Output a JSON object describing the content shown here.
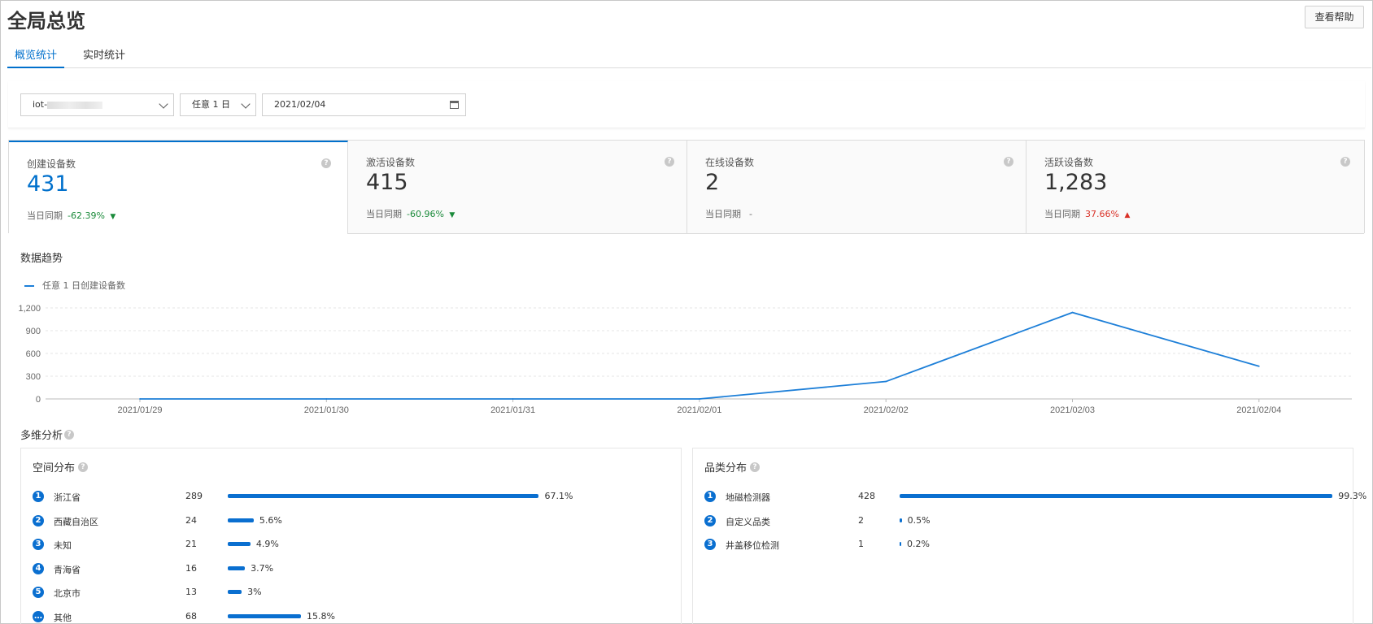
{
  "page": {
    "title": "全局总览",
    "help_label": "查看帮助"
  },
  "tabs": [
    {
      "label": "概览统计"
    },
    {
      "label": "实时统计"
    }
  ],
  "filters": {
    "instance_prefix": "iot-",
    "period": "任意 1 日",
    "date": "2021/02/04"
  },
  "cards": [
    {
      "label": "创建设备数",
      "value": "431",
      "meta_label": "当日同期",
      "pct": "-62.39%",
      "trend": "down"
    },
    {
      "label": "激活设备数",
      "value": "415",
      "meta_label": "当日同期",
      "pct": "-60.96%",
      "trend": "down"
    },
    {
      "label": "在线设备数",
      "value": "2",
      "meta_label": "当日同期",
      "pct": "-",
      "trend": "none"
    },
    {
      "label": "活跃设备数",
      "value": "1,283",
      "meta_label": "当日同期",
      "pct": "37.66%",
      "trend": "up"
    }
  ],
  "trend_title": "数据趋势",
  "chart_data": {
    "type": "line",
    "title": "",
    "series": [
      {
        "name": "任意 1 日创建设备数",
        "values": [
          0,
          0,
          0,
          0,
          230,
          1140,
          431
        ]
      }
    ],
    "x": [
      "2021/01/29",
      "2021/01/30",
      "2021/01/31",
      "2021/02/01",
      "2021/02/02",
      "2021/02/03",
      "2021/02/04"
    ],
    "yticks": [
      "0",
      "300",
      "600",
      "900",
      "1,200"
    ],
    "ylim": [
      0,
      1200
    ],
    "grid": true,
    "color": "#1d7fd8"
  },
  "analysis_title": "多维分析",
  "space": {
    "title": "空间分布",
    "rows": [
      {
        "rank": "1",
        "name": "浙江省",
        "count": "289",
        "pct_label": "67.1%",
        "pct": 67.1
      },
      {
        "rank": "2",
        "name": "西藏自治区",
        "count": "24",
        "pct_label": "5.6%",
        "pct": 5.6
      },
      {
        "rank": "3",
        "name": "未知",
        "count": "21",
        "pct_label": "4.9%",
        "pct": 4.9
      },
      {
        "rank": "4",
        "name": "青海省",
        "count": "16",
        "pct_label": "3.7%",
        "pct": 3.7
      },
      {
        "rank": "5",
        "name": "北京市",
        "count": "13",
        "pct_label": "3%",
        "pct": 3
      },
      {
        "rank": "…",
        "name": "其他",
        "count": "68",
        "pct_label": "15.8%",
        "pct": 15.8
      }
    ]
  },
  "category": {
    "title": "品类分布",
    "rows": [
      {
        "rank": "1",
        "name": "地磁检测器",
        "count": "428",
        "pct_label": "99.3%",
        "pct": 99.3
      },
      {
        "rank": "2",
        "name": "自定义品类",
        "count": "2",
        "pct_label": "0.5%",
        "pct": 0.5
      },
      {
        "rank": "3",
        "name": "井盖移位检测",
        "count": "1",
        "pct_label": "0.2%",
        "pct": 0.2
      }
    ]
  },
  "colors": {
    "accent": "#0070cc",
    "down": "#1a8a3a",
    "up": "#d93026",
    "bar": "#0a6fd0"
  }
}
